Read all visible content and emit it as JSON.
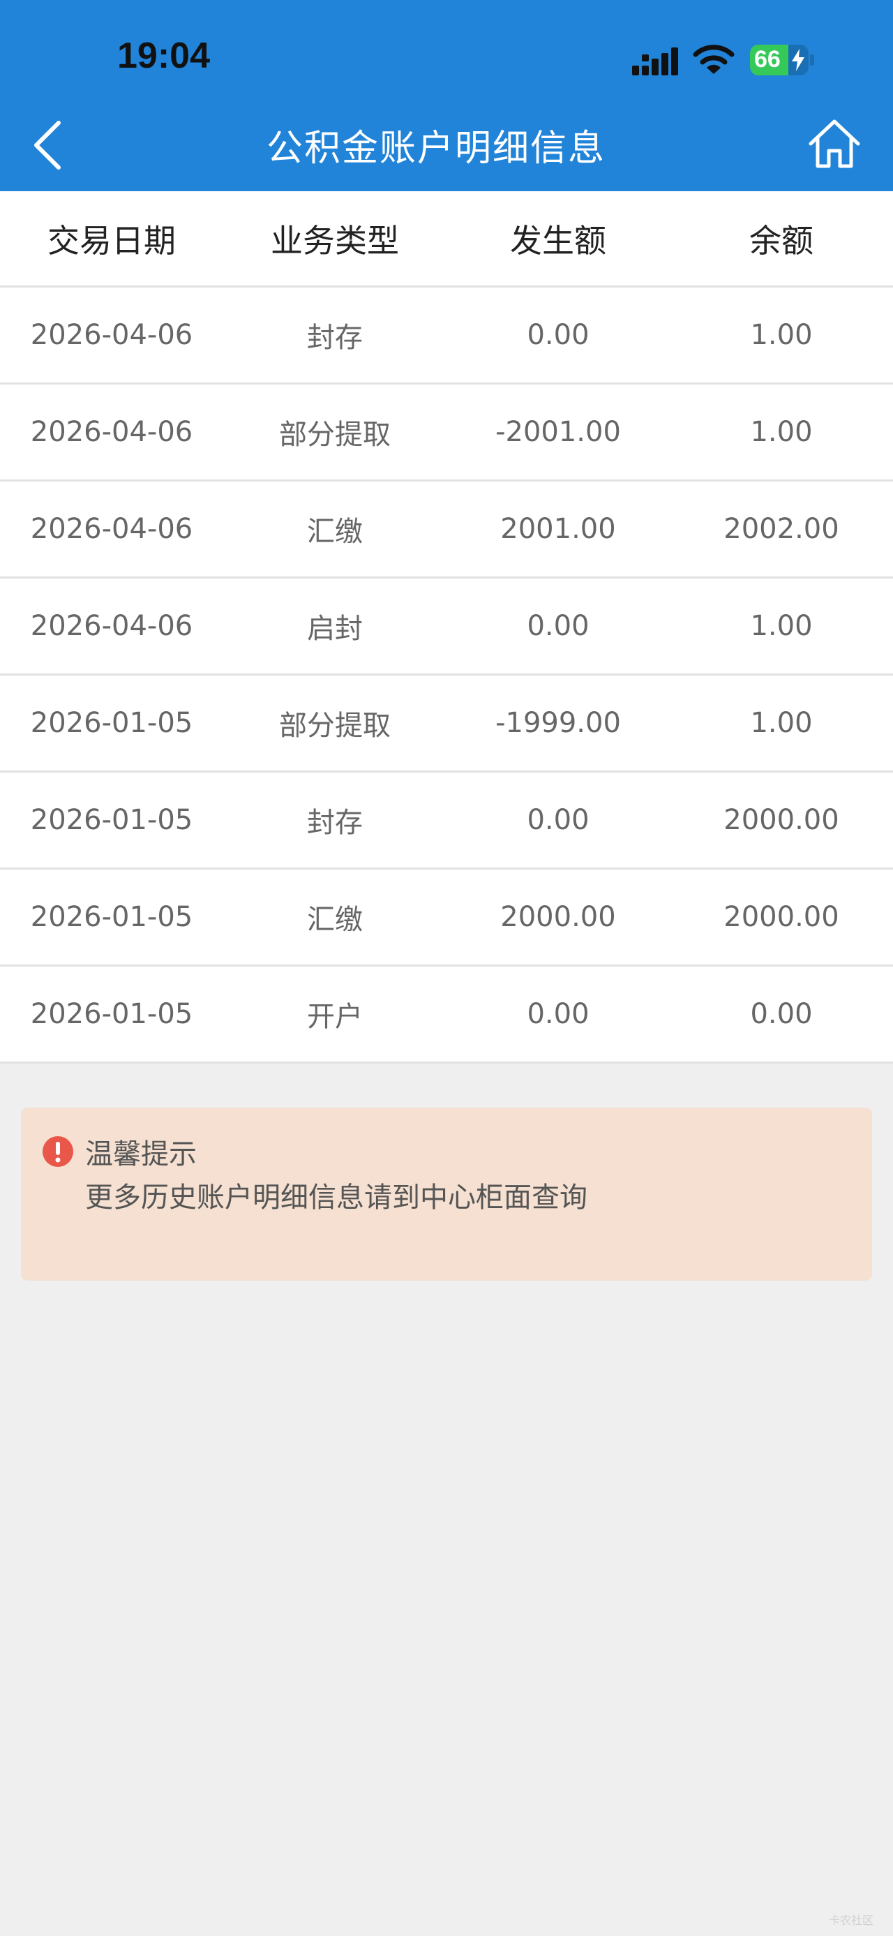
{
  "status_bar": {
    "time": "19:04",
    "battery_level": "66",
    "battery_fraction": 0.66,
    "icons": [
      "signal-icon",
      "wifi-icon",
      "battery-icon",
      "charging-bolt-icon"
    ]
  },
  "nav": {
    "title": "公积金账户明细信息",
    "back_icon": "chevron-left-icon",
    "home_icon": "home-icon"
  },
  "colors": {
    "header_blue": "#2184d8",
    "tip_background": "#f5e0d1",
    "tip_icon_red": "#e8574a",
    "page_background": "#efefef"
  },
  "table": {
    "headers": [
      "交易日期",
      "业务类型",
      "发生额",
      "余额"
    ],
    "rows": [
      [
        "2026-04-06",
        "封存",
        "0.00",
        "1.00"
      ],
      [
        "2026-04-06",
        "部分提取",
        "-2001.00",
        "1.00"
      ],
      [
        "2026-04-06",
        "汇缴",
        "2001.00",
        "2002.00"
      ],
      [
        "2026-04-06",
        "启封",
        "0.00",
        "1.00"
      ],
      [
        "2026-01-05",
        "部分提取",
        "-1999.00",
        "1.00"
      ],
      [
        "2026-01-05",
        "封存",
        "0.00",
        "2000.00"
      ],
      [
        "2026-01-05",
        "汇缴",
        "2000.00",
        "2000.00"
      ],
      [
        "2026-01-05",
        "开户",
        "0.00",
        "0.00"
      ]
    ]
  },
  "tip": {
    "icon": "exclamation-circle-icon",
    "title": "温馨提示",
    "text": "更多历史账户明细信息请到中心柜面查询"
  },
  "watermark": "卡农社区"
}
